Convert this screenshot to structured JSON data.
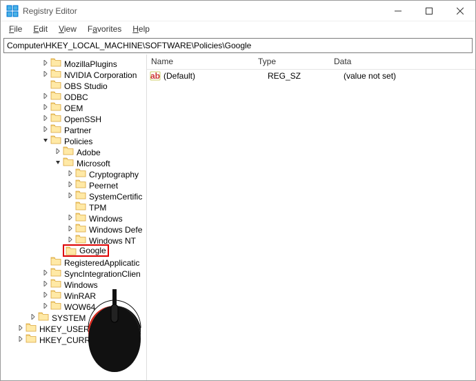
{
  "window": {
    "title": "Registry Editor"
  },
  "menu": {
    "file": "File",
    "edit": "Edit",
    "view": "View",
    "favorites": "Favorites",
    "help": "Help"
  },
  "address": {
    "path": "Computer\\HKEY_LOCAL_MACHINE\\SOFTWARE\\Policies\\Google"
  },
  "tree": {
    "items": [
      {
        "label": "MozillaPlugins",
        "indent": 3,
        "twisty": ">"
      },
      {
        "label": "NVIDIA Corporation",
        "indent": 3,
        "twisty": ">"
      },
      {
        "label": "OBS Studio",
        "indent": 3,
        "twisty": ""
      },
      {
        "label": "ODBC",
        "indent": 3,
        "twisty": ">"
      },
      {
        "label": "OEM",
        "indent": 3,
        "twisty": ">"
      },
      {
        "label": "OpenSSH",
        "indent": 3,
        "twisty": ">"
      },
      {
        "label": "Partner",
        "indent": 3,
        "twisty": ">"
      },
      {
        "label": "Policies",
        "indent": 3,
        "twisty": "v"
      },
      {
        "label": "Adobe",
        "indent": 4,
        "twisty": ">"
      },
      {
        "label": "Microsoft",
        "indent": 4,
        "twisty": "v"
      },
      {
        "label": "Cryptography",
        "indent": 5,
        "twisty": ">"
      },
      {
        "label": "Peernet",
        "indent": 5,
        "twisty": ">"
      },
      {
        "label": "SystemCertific",
        "indent": 5,
        "twisty": ">"
      },
      {
        "label": "TPM",
        "indent": 5,
        "twisty": ""
      },
      {
        "label": "Windows",
        "indent": 5,
        "twisty": ">"
      },
      {
        "label": "Windows Defe",
        "indent": 5,
        "twisty": ">"
      },
      {
        "label": "Windows NT",
        "indent": 5,
        "twisty": ">"
      },
      {
        "label": "Google",
        "indent": 4,
        "twisty": "",
        "highlight": true
      },
      {
        "label": "RegisteredApplicatic",
        "indent": 3,
        "twisty": ""
      },
      {
        "label": "SyncIntegrationClien",
        "indent": 3,
        "twisty": ">"
      },
      {
        "label": "Windows",
        "indent": 3,
        "twisty": ">"
      },
      {
        "label": "WinRAR",
        "indent": 3,
        "twisty": ">"
      },
      {
        "label": "WOW64",
        "indent": 3,
        "twisty": ">"
      },
      {
        "label": "SYSTEM",
        "indent": 2,
        "twisty": ">"
      },
      {
        "label": "HKEY_USERS",
        "indent": 1,
        "twisty": ">"
      },
      {
        "label": "HKEY_CURREN",
        "indent": 1,
        "twisty": ">"
      }
    ]
  },
  "list": {
    "columns": {
      "name": "Name",
      "type": "Type",
      "data": "Data"
    },
    "rows": [
      {
        "name": "(Default)",
        "type": "REG_SZ",
        "data": "(value not set)"
      }
    ]
  }
}
